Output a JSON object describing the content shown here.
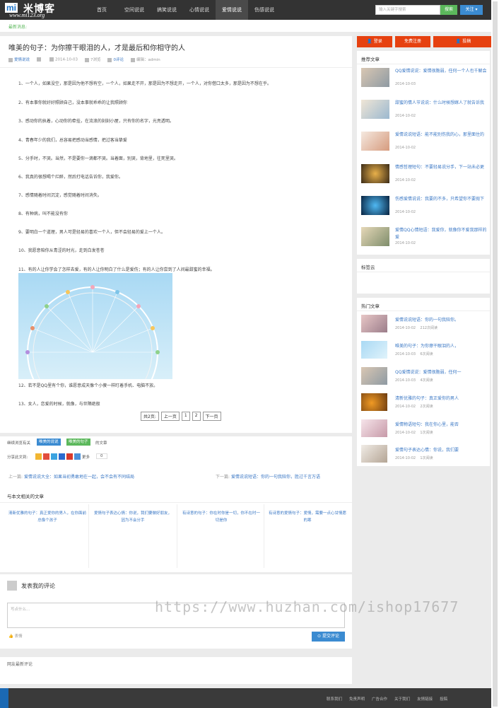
{
  "site": {
    "logo_mi": "mi",
    "logo_cn": "米博客",
    "logo_url": "www.mi123.org"
  },
  "nav": [
    "首页",
    "空间说说",
    "搞笑说说",
    "心情说说",
    "爱情说说",
    "伤感说说"
  ],
  "search": {
    "placeholder": "输入关键字搜索",
    "button": "搜索",
    "follow": "关注 ▾"
  },
  "notice": "最新消息:",
  "article": {
    "title": "唯美的句子：为你擦干眼泪的人，才是最后和你相守的人",
    "category": "爱情说说",
    "date": "2014-10-03",
    "views": "7浏览",
    "comments": "0评论",
    "editor": "编辑：admin",
    "paragraphs": [
      "1、一个人，如果没空，那是因为他不想有空，一个人，如果走不开，那是因为不想走开，一个人，对你借口太多，那是因为不想在乎。",
      "2、有本事你就好好照顾自己，没本事就乖乖的让我照顾你",
      "3、感动你的执着，心动你的牵挂，在流浪的刻刻小屋，只有你的名字，光亮透明。",
      "4、青春年少的我们，总容易把感动当感情，把过客当挚爱",
      "5、分手时，不哭。当然，不是要你一滴都不哭。当着面，别哭，背地里，往死里哭。",
      "6、我真的很想喝个烂醉，然后打电话告诉你，我爱你。",
      "7、感情随着时间沉淀，感觉随着时间消失。",
      "8、有种病，叫不能没有你",
      "9、要明白一个道理，男人可是轻易的喜欢一个人，但不会轻易的爱上一个人。",
      "10、我愿意陪你从青涩的时光，走到白发苍苍",
      "11、有的人让你学会了怎样去爱，有的人让你明白了什么是爱伤；有的人让你尝到了人间最甜蜜的幸福。",
      "12、若不是QQ里有个你，谁愿意成天像个小傻一样盯着手机、电脑不放。",
      "13、女人，恋爱的时候，就像，与世隔绝般"
    ],
    "pager": [
      "共2页:",
      "上一页",
      "1",
      "2",
      "下一页"
    ]
  },
  "tags": {
    "label": "继续浏览有关",
    "tag1": "唯美的说说",
    "tag2": "唯美的句子",
    "suffix": "的文章"
  },
  "share": {
    "label": "分享此文到:",
    "more": "更多",
    "count": "0"
  },
  "prevnext": {
    "prev_label": "上一篇:",
    "prev": "爱情说说大全：如果当初勇敢地在一起，会不会有不同结局",
    "next_label": "下一篇:",
    "next": "爱情说说短语：你的一句我陪你，胜过千言万语"
  },
  "related": {
    "title": "与本文相关的文章",
    "items": [
      "清新优雅的句子：真正爱你的男人，在你面前总像个孩子",
      "爱情句子表达心情：你说，我们要做好朋友，因为不会分手",
      "有诗意的句子：你在时你是一切，你不在时一切是你",
      "有诗意的爱情句子：爱情，需要一点心甘情愿的寒"
    ]
  },
  "comment": {
    "title": "发表我的评论",
    "placeholder": "写点什么...",
    "emoji": "表情",
    "submit": "提交评论"
  },
  "latest": "网友最新评论",
  "sidebar": {
    "btn_login": "登录",
    "btn_register": "免费注册",
    "btn_contribute": "投稿",
    "recommend_title": "推荐文章",
    "recommend": [
      {
        "title": "QQ爱情说说：爱情很脆弱，任何一个人也千解会",
        "date": "2014-10-03"
      },
      {
        "title": "甜蜜的情人节说说：什么时候想嫁人了就告诉我",
        "date": "2014-10-02"
      },
      {
        "title": "爱情说说短语：能不能别伤我的心，那里面住的",
        "date": "2014-10-02"
      },
      {
        "title": "情感哲理短句：不要轻易说分手，下一站未必更",
        "date": "2014-10-02"
      },
      {
        "title": "伤感爱情说说：我要的不多，只希望你不要抛下",
        "date": "2014-10-02"
      },
      {
        "title": "爱情QQ心情短语：我爱你，就像你不爱我那样的爱",
        "date": "2014-10-02"
      }
    ],
    "tagcloud_title": "标签云",
    "hot_title": "热门文章",
    "hot": [
      {
        "title": "爱情说说短语：你的一句我陪你。",
        "date": "2014-10-02",
        "views": "212次阅读"
      },
      {
        "title": "唯美的句子：为你擦干眼泪的人，",
        "date": "2014-10-03",
        "views": "6次阅读"
      },
      {
        "title": "QQ爱情说说：爱情很脆弱，任何一",
        "date": "2014-10-03",
        "views": "4次阅读"
      },
      {
        "title": "清新优雅的句子：真正爱你的男人",
        "date": "2014-10-02",
        "views": "2次阅读"
      },
      {
        "title": "爱情物语短句：我在你心里，能否",
        "date": "2014-10-02",
        "views": "1次阅读"
      },
      {
        "title": "爱情句子表达心情：你说，我们要",
        "date": "2014-10-02",
        "views": "1次阅读"
      }
    ]
  },
  "footer": [
    "联系我们",
    "免责声明",
    "广告合作",
    "关于我们",
    "友情链接",
    "投稿"
  ],
  "watermark": "https://www.huzhan.com/ishop17677",
  "colors": {
    "topbar": "#333333",
    "link": "#3b78c5",
    "orange": "#e64110",
    "green": "#5cb85c",
    "blue": "#3b8bd1"
  }
}
